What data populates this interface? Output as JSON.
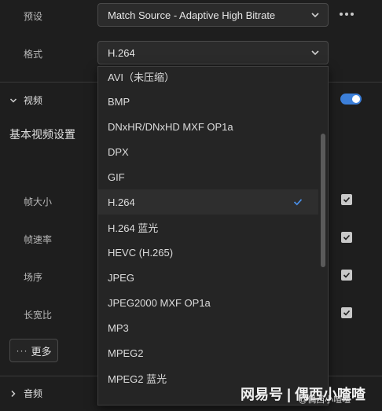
{
  "preset": {
    "label": "预设",
    "value": "Match Source - Adaptive High Bitrate"
  },
  "format": {
    "label": "格式",
    "value": "H.264"
  },
  "video_section": {
    "label": "视频",
    "enabled": true
  },
  "basic_video_settings": {
    "title": "基本视频设置",
    "settings": [
      {
        "label": "帧大小",
        "checked": true
      },
      {
        "label": "帧速率",
        "checked": true
      },
      {
        "label": "场序",
        "checked": true
      },
      {
        "label": "长宽比",
        "checked": true
      }
    ],
    "more_label": "更多"
  },
  "audio_section": {
    "label": "音频"
  },
  "format_dropdown": {
    "selected": "H.264",
    "options": [
      "AVI（未压缩）",
      "BMP",
      "DNxHR/DNxHD MXF OP1a",
      "DPX",
      "GIF",
      "H.264",
      "H.264 蓝光",
      "HEVC (H.265)",
      "JPEG",
      "JPEG2000 MXF OP1a",
      "MP3",
      "MPEG2",
      "MPEG2 蓝光"
    ]
  },
  "watermark": {
    "brand": "网易号 | 偶西小喳喳",
    "handle": "@偶西小喳喳"
  },
  "colors": {
    "accent": "#3c7fd9",
    "background": "#1e1e1e",
    "dropdown_bg": "#252525"
  }
}
